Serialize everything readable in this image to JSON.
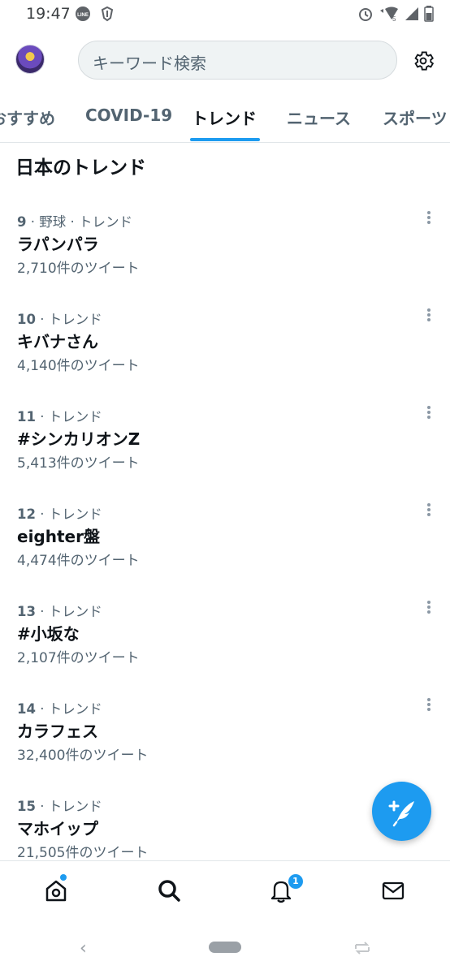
{
  "status_bar": {
    "time": "19:47",
    "left_icons": [
      "line-icon",
      "app-shield-icon"
    ],
    "right_icons": [
      "alarm-icon",
      "wifi-icon",
      "signal-icon",
      "battery-icon"
    ],
    "signal_label": "5"
  },
  "header": {
    "search_placeholder": "キーワード検索"
  },
  "tabs": [
    {
      "label": "おすすめ",
      "active": false
    },
    {
      "label": "COVID-19",
      "active": false
    },
    {
      "label": "トレンド",
      "active": true
    },
    {
      "label": "ニュース",
      "active": false
    },
    {
      "label": "スポーツ",
      "active": false
    }
  ],
  "section_title": "日本のトレンド",
  "trends": [
    {
      "rank": "9",
      "meta": " · 野球 · トレンド",
      "name": "ラパンパラ",
      "count": "2,710件のツイート"
    },
    {
      "rank": "10",
      "meta": " · トレンド",
      "name": "キバナさん",
      "count": "4,140件のツイート"
    },
    {
      "rank": "11",
      "meta": " · トレンド",
      "name": "#シンカリオンZ",
      "count": "5,413件のツイート"
    },
    {
      "rank": "12",
      "meta": " · トレンド",
      "name": "eighter盤",
      "count": "4,474件のツイート"
    },
    {
      "rank": "13",
      "meta": " · トレンド",
      "name": "#小坂な",
      "count": "2,107件のツイート"
    },
    {
      "rank": "14",
      "meta": " · トレンド",
      "name": "カラフェス",
      "count": "32,400件のツイート"
    },
    {
      "rank": "15",
      "meta": " · トレンド",
      "name": "マホイップ",
      "count": "21,505件のツイート"
    }
  ],
  "bottom_nav": {
    "items": [
      "home-icon",
      "search-icon",
      "notifications-icon",
      "messages-icon"
    ],
    "notifications_badge": "1"
  },
  "colors": {
    "accent": "#1d9bf0",
    "text_primary": "#0f1419",
    "text_secondary": "#536471"
  }
}
